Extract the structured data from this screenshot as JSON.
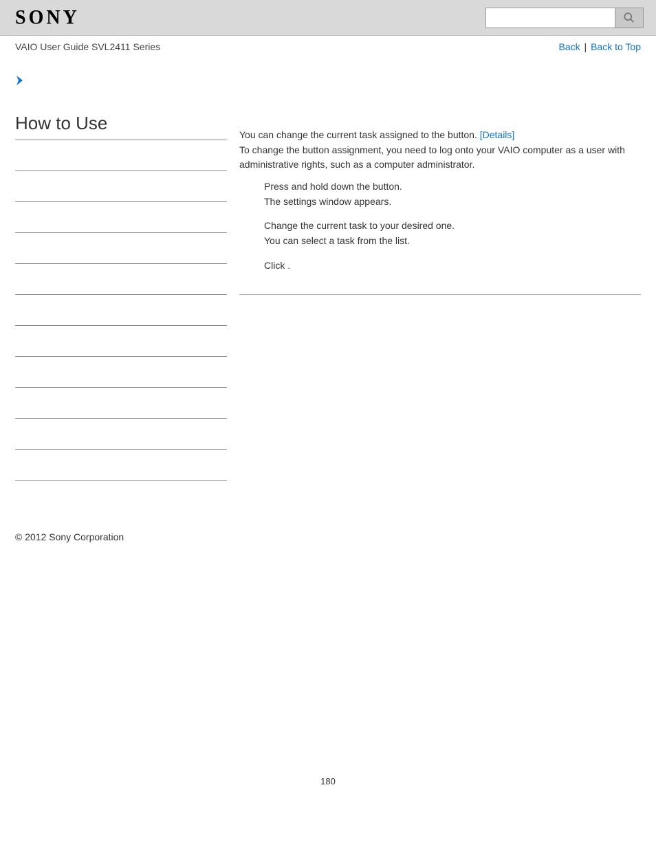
{
  "header": {
    "logo_text": "SONY",
    "search_placeholder": ""
  },
  "topnav": {
    "guide_title": "VAIO User Guide SVL2411 Series",
    "back_label": "Back",
    "separator": " | ",
    "back_to_top_label": "Back to Top"
  },
  "sidebar": {
    "heading": "How to Use",
    "item_count": 12
  },
  "main": {
    "intro_part1": "You can change the current task assigned to the ",
    "intro_button_placeholder": "",
    "intro_part2": " button. ",
    "details_link": "[Details]",
    "intro_line2": "To change the button assignment, you need to log onto your VAIO computer as a user with administrative rights, such as a computer administrator.",
    "steps": [
      {
        "line1_part1": "Press and hold down the ",
        "line1_button_placeholder": "",
        "line1_part2": " button.",
        "line2": "The settings window appears."
      },
      {
        "line1": "Change the current task to your desired one.",
        "line2": "You can select a task from the list."
      },
      {
        "line1_part1": "Click ",
        "line1_ok_placeholder": "",
        "line1_part2": "."
      }
    ]
  },
  "footer": {
    "copyright": "© 2012 Sony Corporation",
    "page_number": "180"
  }
}
